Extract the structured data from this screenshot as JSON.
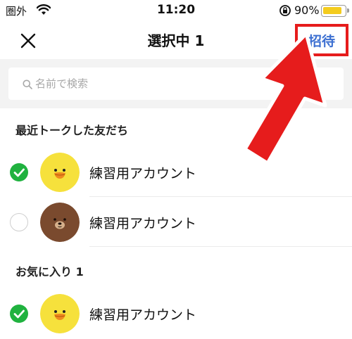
{
  "status_bar": {
    "carrier": "圏外",
    "time": "11:20",
    "battery_percent": "90%",
    "battery_level": 0.9,
    "battery_color": "#f4cc1e"
  },
  "header": {
    "close_icon": "close-icon",
    "title": "選択中 1",
    "invite_label": "招待",
    "invite_color": "#3c6fd1",
    "highlight_color": "#e61c1c"
  },
  "search": {
    "placeholder": "名前で検索",
    "value": ""
  },
  "sections": [
    {
      "title": "最近トークした友だち",
      "items": [
        {
          "name": "練習用アカウント",
          "selected": true,
          "avatar": "sally-chick-avatar"
        },
        {
          "name": "練習用アカウント",
          "selected": false,
          "avatar": "brown-bear-avatar"
        }
      ]
    },
    {
      "title": "お気に入り 1",
      "items": [
        {
          "name": "練習用アカウント",
          "selected": true,
          "avatar": "sally-chick-avatar"
        }
      ]
    }
  ],
  "annotation": {
    "arrow_icon": "red-arrow-icon",
    "color": "#e61c1c"
  },
  "accent_check_color": "#20b23f"
}
